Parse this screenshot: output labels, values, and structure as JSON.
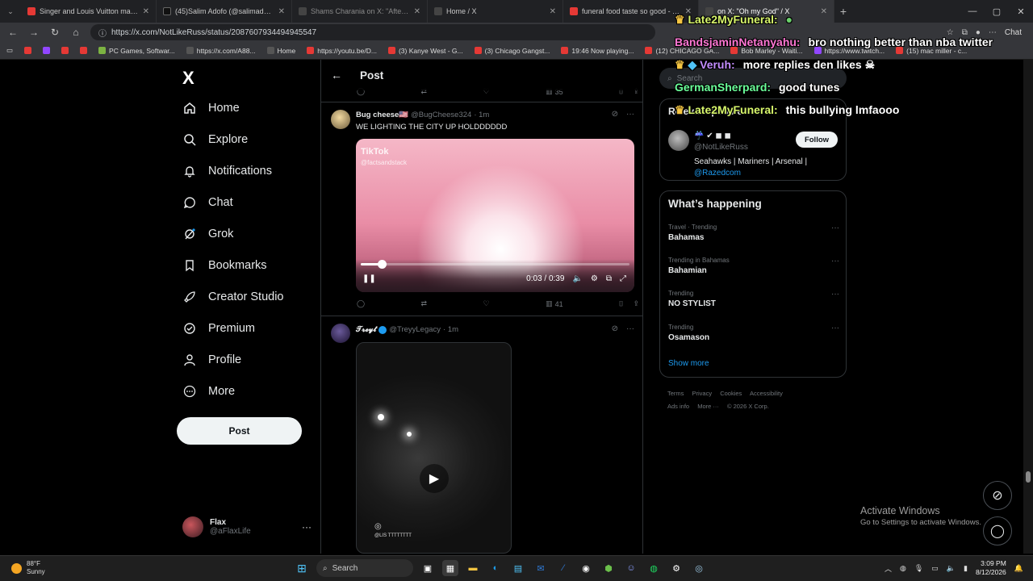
{
  "browser": {
    "tabs": [
      {
        "label": "Singer and Louis Vuitton made a c",
        "color": "#e53935",
        "active": false
      },
      {
        "label": "(45)Salim Adofo (@salimadofo)'s v",
        "color": "#111111",
        "active": false
      },
      {
        "label": "Shams Charania on X: \"After 18 N",
        "color": "#444444",
        "active": false
      },
      {
        "label": "Home / X",
        "color": "#444444",
        "active": false
      },
      {
        "label": "funeral food taste so good - YouTu",
        "color": "#e53935",
        "active": false
      },
      {
        "label": "on X: \"Oh my God\" / X",
        "color": "#444444",
        "active": true
      }
    ],
    "url": "https://x.com/NotLikeRuss/status/2087607934494945547",
    "chat_label": "Chat",
    "bookmarks": [
      "PC Games, Softwar...",
      "https://x.com/A88...",
      "Home",
      "https://youtu.be/D...",
      "(3) Kanye West - G...",
      "(3) Chicago Gangst...",
      "19:46 Now playing...",
      "(12) CHICAGO GA...",
      "Bob Marley - Waiti...",
      "https://www.twitch...",
      "(15) mac miller - c..."
    ]
  },
  "nav": {
    "logo": "X",
    "items": [
      "Home",
      "Explore",
      "Notifications",
      "Chat",
      "Grok",
      "Bookmarks",
      "Creator Studio",
      "Premium",
      "Profile",
      "More"
    ],
    "post_label": "Post",
    "account": {
      "name": "Flax",
      "handle": "@aFlaxLife"
    }
  },
  "post_header": {
    "title": "Post"
  },
  "top_actions": {
    "views": "35"
  },
  "tweets": [
    {
      "name": "Bug cheese🇺🇸",
      "handle": "@BugCheese324",
      "time": "· 1m",
      "text": "WE LIGHTING THE CITY UP HOLDDDDDD",
      "video": {
        "watermark": "TikTok",
        "watermark_handle": "@factsandstack",
        "time": "0:03 / 0:39",
        "progress": 0.077
      },
      "views": "41"
    },
    {
      "name": "𝓣𝓻𝓮𝔂𝓽",
      "handle": "@TreyyLegacy",
      "time": "· 1m",
      "video_tag": "@LIS TTTTTTTT"
    }
  ],
  "sidebar": {
    "search_placeholder": "Search",
    "relevant": {
      "title": "Relevant people",
      "handle": "@NotLikeRuss",
      "follow_label": "Follow",
      "bio": "Seahawks | Mariners | Arsenal |",
      "bio_link": "@Razedcom"
    },
    "happening_title": "What’s happening",
    "trends": [
      {
        "context": "Travel · Trending",
        "title": "Bahamas"
      },
      {
        "context": "Trending in Bahamas",
        "title": "Bahamian"
      },
      {
        "context": "Trending",
        "title": "NO STYLIST"
      },
      {
        "context": "Trending",
        "title": "Osamason"
      }
    ],
    "show_more": "Show more",
    "footer_links": [
      "Terms",
      "Privacy",
      "Cookies",
      "Accessibility",
      "Ads info",
      "More ···",
      "© 2026 X Corp."
    ]
  },
  "watermark": {
    "title": "Activate Windows",
    "subtitle": "Go to Settings to activate Windows."
  },
  "stream_chat": [
    {
      "user": "Late2MyFuneral:",
      "msg": "",
      "color": "#d7f56b"
    },
    {
      "user": "BandsjaminNetanyahu:",
      "msg": "bro nothing better than nba twitter",
      "color": "#ff77d4"
    },
    {
      "user": "Veruh:",
      "msg": "more replies den likes",
      "color": "#c38dff"
    },
    {
      "user": "GermanSherpard:",
      "msg": "good tunes",
      "color": "#6bff9a"
    },
    {
      "user": "Late2MyFuneral:",
      "msg": "this bullying lmfaooo",
      "color": "#d7f56b"
    }
  ],
  "taskbar": {
    "weather_temp": "88°F",
    "weather_desc": "Sunny",
    "search_label": "Search",
    "time": "3:09 PM",
    "date": "8/12/2026"
  }
}
